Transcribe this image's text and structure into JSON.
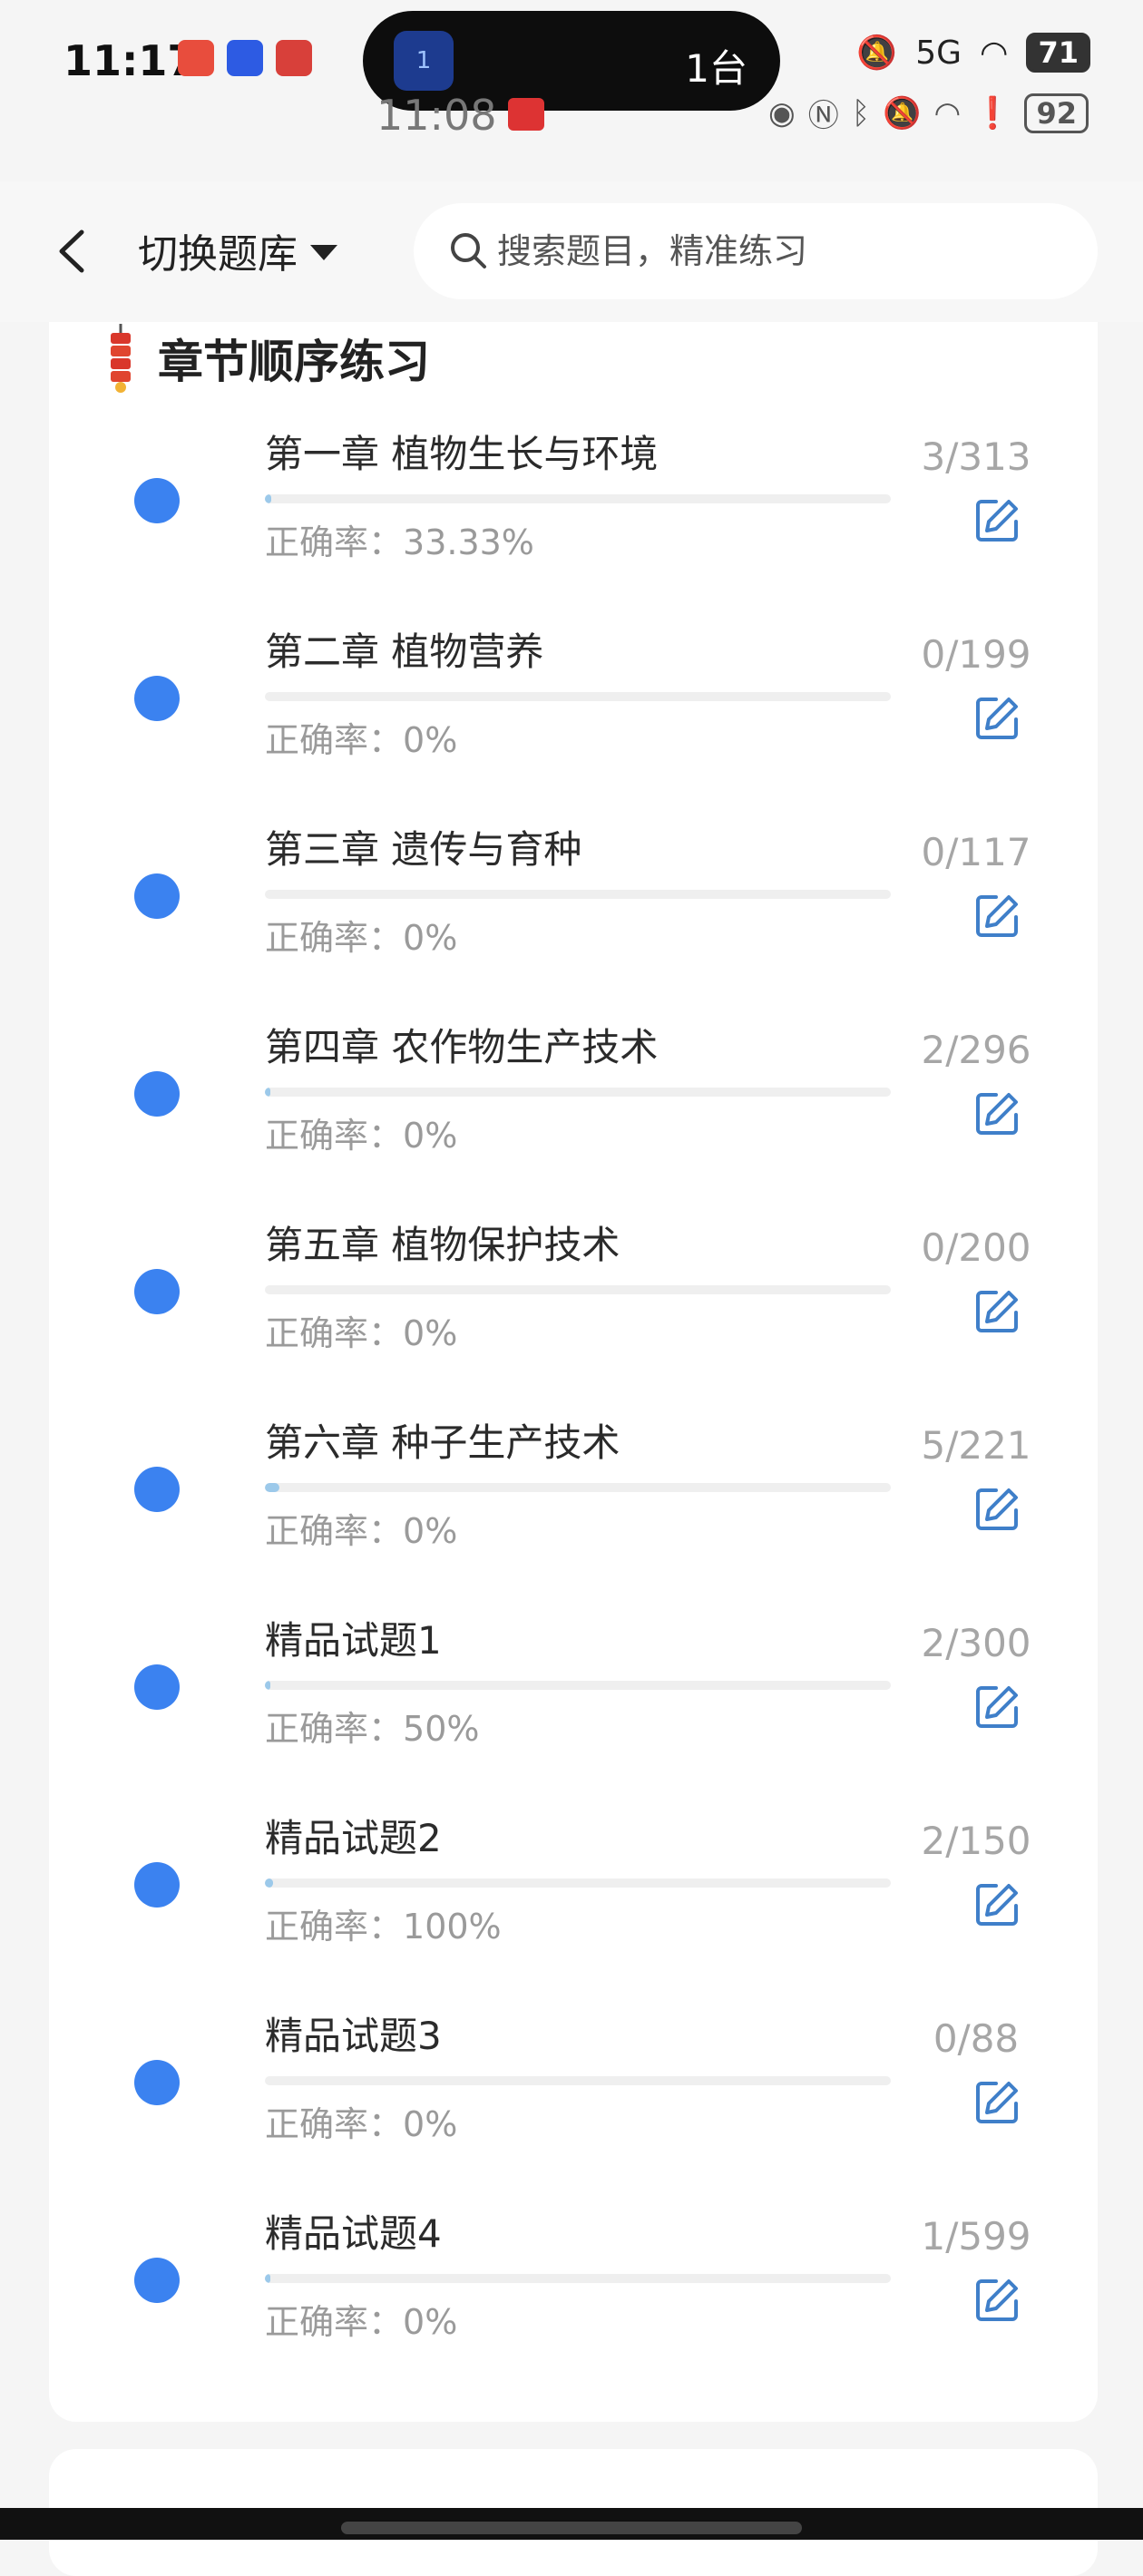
{
  "status_bar": {
    "time": "11:17",
    "pill_text": "1台",
    "pill_badge": "1",
    "battery": "71",
    "signal": "5G"
  },
  "status_bar_ghost": {
    "time": "11:08",
    "battery": "92"
  },
  "nav": {
    "switch_label": "切换题库",
    "search_placeholder": "搜索题目，精准练习"
  },
  "section": {
    "title": "章节顺序练习"
  },
  "chapters": [
    {
      "title": "第一章 植物生长与环境",
      "accuracy_label": "正确率：",
      "accuracy": "33.33%",
      "done": 3,
      "total": 313,
      "count": "3/313"
    },
    {
      "title": "第二章 植物营养",
      "accuracy_label": "正确率：",
      "accuracy": "0%",
      "done": 0,
      "total": 199,
      "count": "0/199"
    },
    {
      "title": "第三章 遗传与育种",
      "accuracy_label": "正确率：",
      "accuracy": "0%",
      "done": 0,
      "total": 117,
      "count": "0/117"
    },
    {
      "title": "第四章 农作物生产技术",
      "accuracy_label": "正确率：",
      "accuracy": "0%",
      "done": 2,
      "total": 296,
      "count": "2/296"
    },
    {
      "title": "第五章 植物保护技术",
      "accuracy_label": "正确率：",
      "accuracy": "0%",
      "done": 0,
      "total": 200,
      "count": "0/200"
    },
    {
      "title": "第六章 种子生产技术",
      "accuracy_label": "正确率：",
      "accuracy": "0%",
      "done": 5,
      "total": 221,
      "count": "5/221"
    },
    {
      "title": "精品试题1",
      "accuracy_label": "正确率：",
      "accuracy": "50%",
      "done": 2,
      "total": 300,
      "count": "2/300"
    },
    {
      "title": "精品试题2",
      "accuracy_label": "正确率：",
      "accuracy": "100%",
      "done": 2,
      "total": 150,
      "count": "2/150"
    },
    {
      "title": "精品试题3",
      "accuracy_label": "正确率：",
      "accuracy": "0%",
      "done": 0,
      "total": 88,
      "count": "0/88"
    },
    {
      "title": "精品试题4",
      "accuracy_label": "正确率：",
      "accuracy": "0%",
      "done": 1,
      "total": 599,
      "count": "1/599"
    }
  ],
  "colors": {
    "accent": "#3b82f0",
    "progress": "#9cc9ea",
    "edit": "#3f7fc9",
    "muted": "#a6a6a6"
  }
}
